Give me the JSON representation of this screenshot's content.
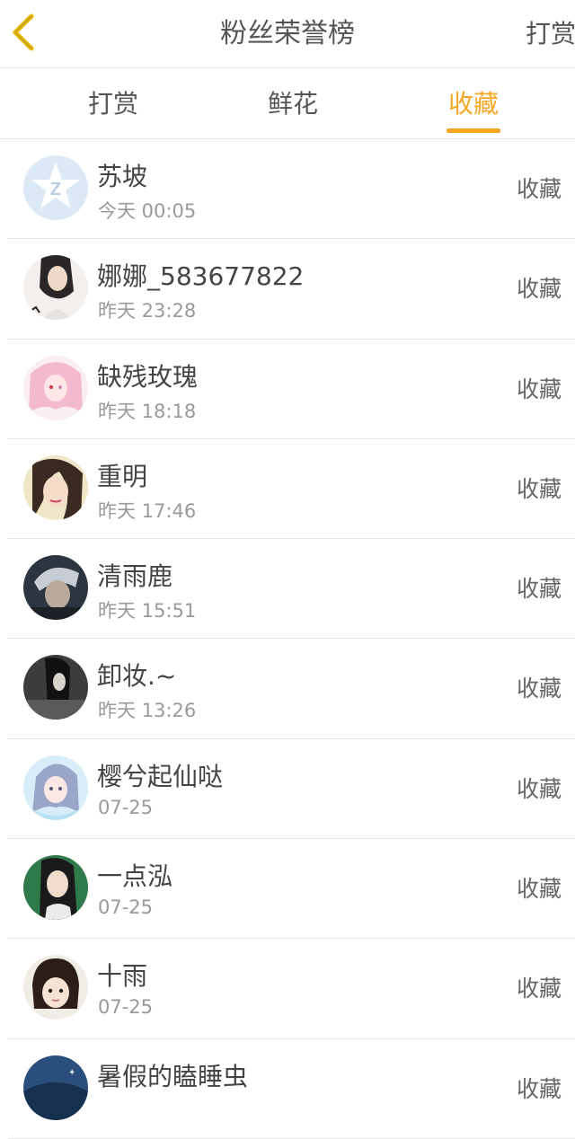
{
  "header": {
    "back_icon": "chevron-left-icon",
    "title": "粉丝荣誉榜",
    "right_label": "打赏"
  },
  "colors": {
    "accent": "#f5a623",
    "back_icon": "#e8b800",
    "text": "#444444",
    "muted": "#9a9a9a",
    "divider": "#e6e6e6"
  },
  "tabs": [
    {
      "label": "打赏",
      "active": false
    },
    {
      "label": "鲜花",
      "active": false
    },
    {
      "label": "收藏",
      "active": true
    }
  ],
  "fans": [
    {
      "name": "苏坡",
      "time": "今天 00:05",
      "action": "收藏",
      "avatar": "default-qq-avatar"
    },
    {
      "name": "娜娜_583677822",
      "time": "昨天 23:28",
      "action": "收藏",
      "avatar": "photo-avatar"
    },
    {
      "name": "缺残玫瑰",
      "time": "昨天 18:18",
      "action": "收藏",
      "avatar": "anime-avatar"
    },
    {
      "name": "重明",
      "time": "昨天 17:46",
      "action": "收藏",
      "avatar": "photo-avatar"
    },
    {
      "name": "清雨鹿",
      "time": "昨天 15:51",
      "action": "收藏",
      "avatar": "photo-avatar"
    },
    {
      "name": "卸妆.~",
      "time": "昨天 13:26",
      "action": "收藏",
      "avatar": "photo-avatar"
    },
    {
      "name": "樱兮起仙哒",
      "time": "07-25",
      "action": "收藏",
      "avatar": "anime-avatar"
    },
    {
      "name": "一点泓",
      "time": "07-25",
      "action": "收藏",
      "avatar": "photo-avatar"
    },
    {
      "name": "十雨",
      "time": "07-25",
      "action": "收藏",
      "avatar": "photo-avatar"
    },
    {
      "name": "暑假的瞌睡虫",
      "time": "",
      "action": "收藏",
      "avatar": "photo-avatar"
    }
  ]
}
